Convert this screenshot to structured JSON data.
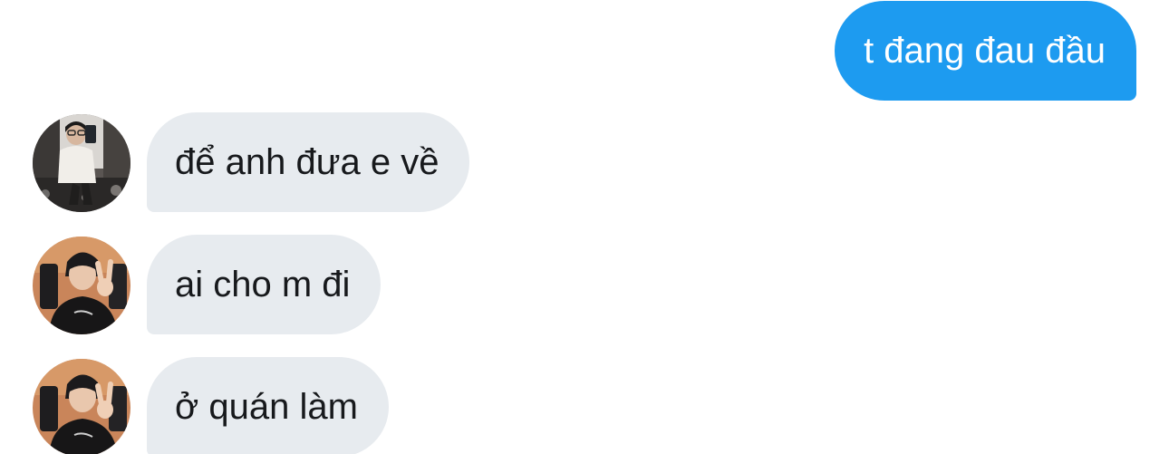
{
  "colors": {
    "outgoing_bubble": "#1d9bf0",
    "outgoing_text": "#ffffff",
    "incoming_bubble": "#e7ebef",
    "incoming_text": "#17191c"
  },
  "messages": [
    {
      "direction": "outgoing",
      "text": "t đang đau đầu"
    },
    {
      "direction": "incoming",
      "text": "để anh đưa e về",
      "avatar_icon": "mirror-selfie-avatar-icon"
    },
    {
      "direction": "incoming",
      "text": "ai cho m đi",
      "avatar_icon": "peace-sign-avatar-icon"
    },
    {
      "direction": "incoming",
      "text": "ở quán làm",
      "avatar_icon": "peace-sign-avatar-icon"
    }
  ]
}
